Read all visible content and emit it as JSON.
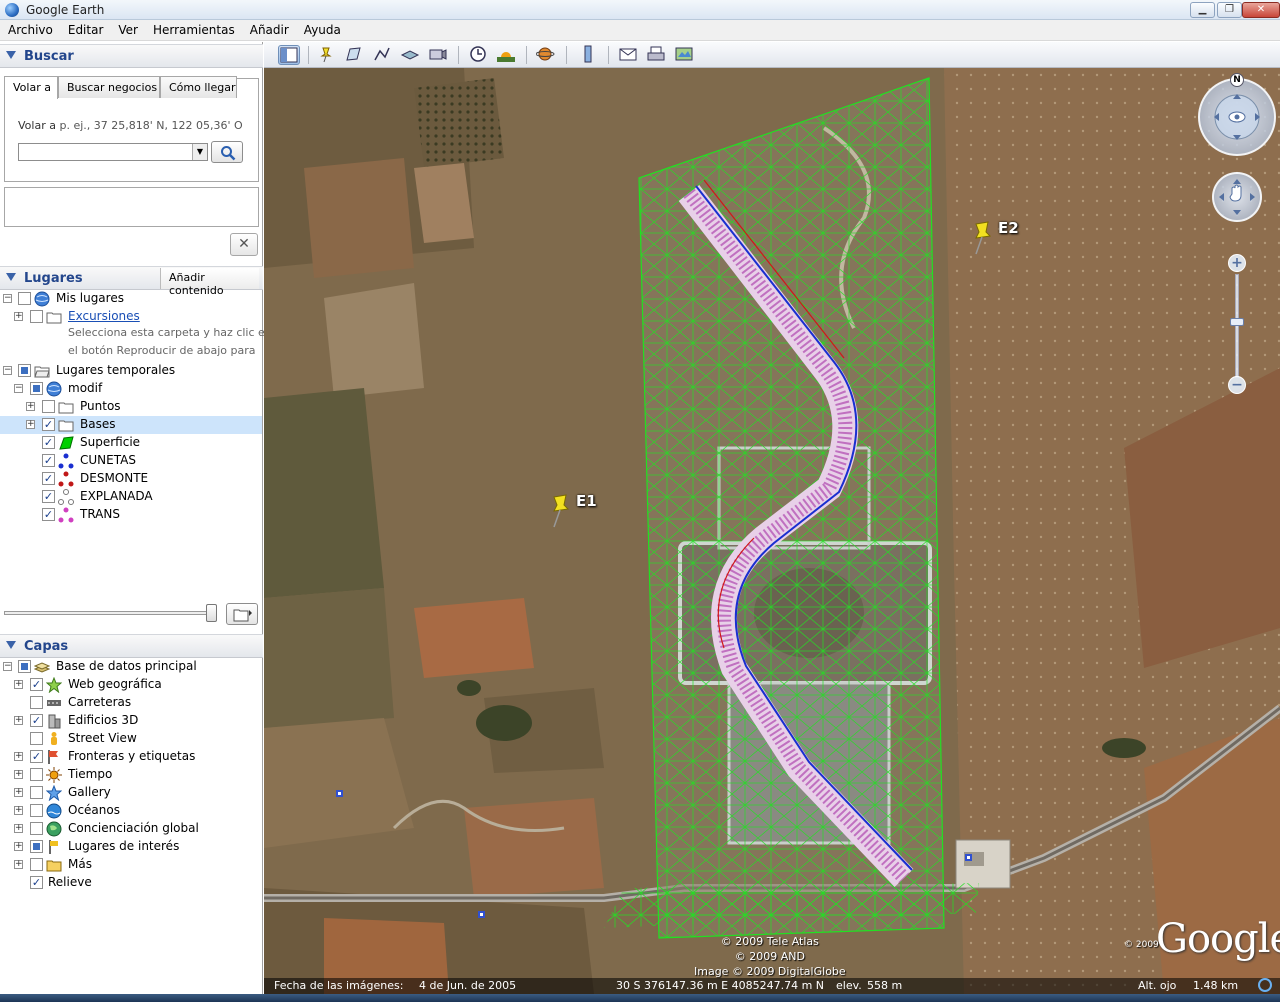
{
  "window": {
    "title": "Google Earth",
    "minimize_label": "▁",
    "maximize_label": "❐",
    "close_label": "✕"
  },
  "menu": [
    "Archivo",
    "Editar",
    "Ver",
    "Herramientas",
    "Añadir",
    "Ayuda"
  ],
  "search": {
    "section_title": "Buscar",
    "tabs": [
      "Volar a",
      "Buscar negocios",
      "Cómo llegar"
    ],
    "fly_to_label": "Volar a",
    "fly_to_hint": "p. ej., 37 25,818' N, 122 05,36' O",
    "fly_to_value": "",
    "clear_label": "✕"
  },
  "places": {
    "section_title": "Lugares",
    "add_content_label": "Añadir contenido",
    "my_places": "Mis lugares",
    "excursiones": "Excursiones",
    "excursiones_note_1": "Selecciona esta carpeta y haz clic en",
    "excursiones_note_2": "el botón Reproducir de abajo para",
    "temporary": "Lugares temporales",
    "modif": "modif",
    "items": [
      "Puntos",
      "Bases",
      "Superficie",
      "CUNETAS",
      "DESMONTE",
      "EXPLANADA",
      "TRANS"
    ]
  },
  "layers": {
    "section_title": "Capas",
    "root": "Base de datos principal",
    "items": [
      "Web geográfica",
      "Carreteras",
      "Edificios 3D",
      "Street View",
      "Fronteras y etiquetas",
      "Tiempo",
      "Gallery",
      "Océanos",
      "Concienciación global",
      "Lugares de interés",
      "Más",
      "Relieve"
    ]
  },
  "map": {
    "placemarks": [
      "E1",
      "E2"
    ],
    "compass_north": "N",
    "copyright_1": "© 2009 Tele Atlas",
    "copyright_2": "© 2009 AND",
    "copyright_3": "Image © 2009 DigitalGlobe",
    "google_year": "© 2009",
    "google_logo": "Google"
  },
  "status": {
    "image_date_label": "Fecha de las imágenes:",
    "image_date": "4 de Jun. de 2005",
    "coords": "30 S 376147.36 m E 4085247.74 m N",
    "elev_label": "elev.",
    "elev": "558 m",
    "eye_alt_label": "Alt. ojo",
    "eye_alt": "1.48 km"
  }
}
